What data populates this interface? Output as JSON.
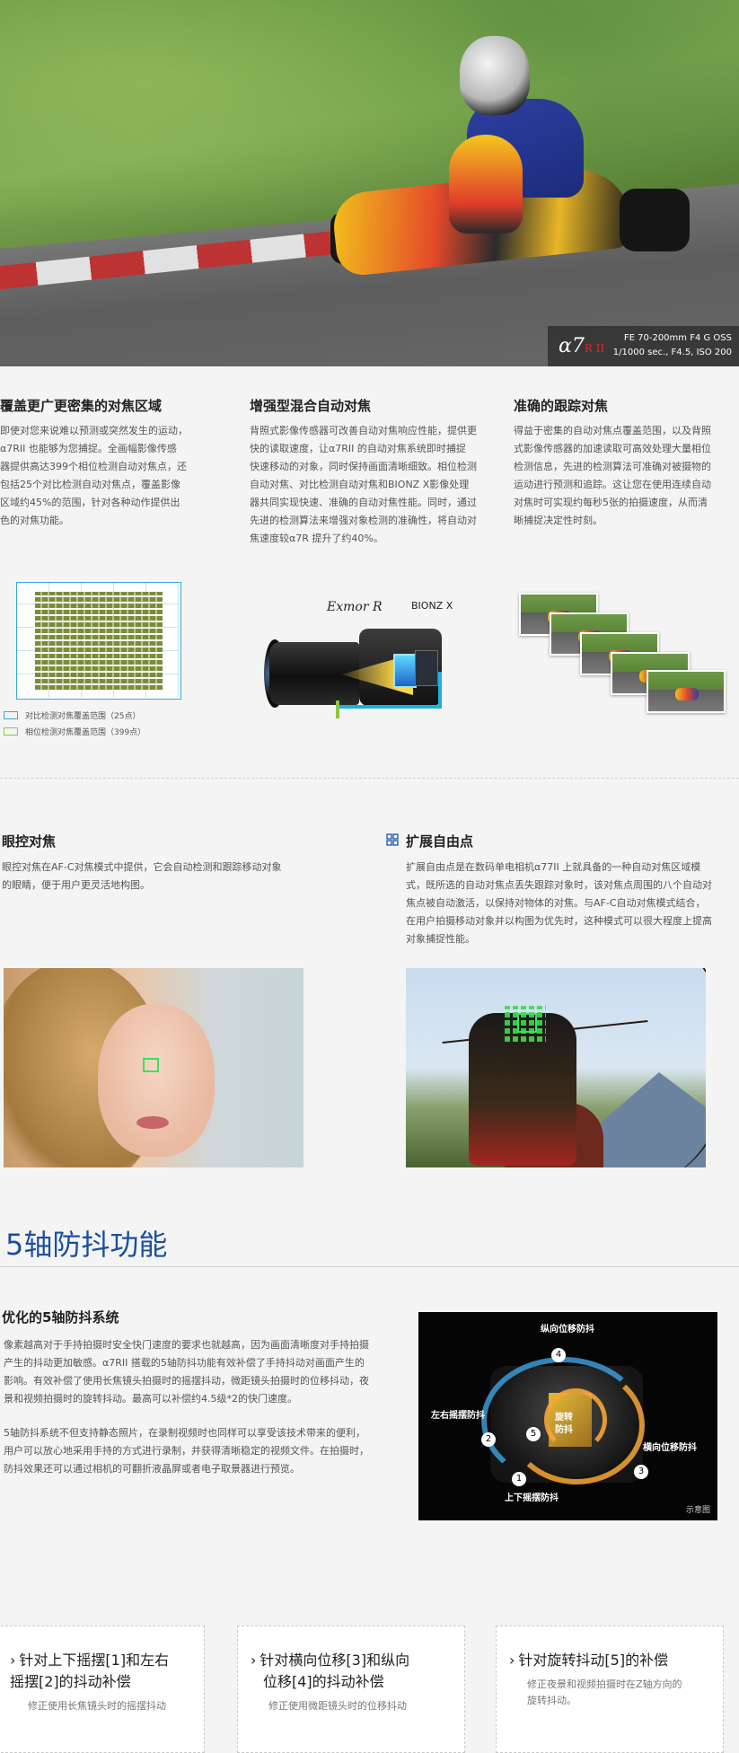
{
  "hero": {
    "badge_logo": "α7",
    "badge_logo_suffix": "R II",
    "badge_line1": "FE 70-200mm F4 G OSS",
    "badge_line2": "1/1000 sec., F4.5, ISO 200"
  },
  "section1": {
    "col1": {
      "title": "覆盖更广更密集的对焦区域",
      "body_lines": [
        "即使对您来说难以预测或突然发生的运动，",
        "α7RII 也能够为您捕捉。全画幅影像传感",
        "器提供高达399个相位检测自动对焦点，还",
        "包括25个对比检测自动对焦点，覆盖影像",
        "区域约45%的范围，针对各种动作提供出",
        "色的对焦功能。"
      ]
    },
    "col2": {
      "title": "增强型混合自动对焦",
      "body_lines": [
        "背照式影像传感器可改善自动对焦响应性能，提供更",
        "快的读取速度，让α7RII 的自动对焦系统即时捕捉",
        "快速移动的对象，同时保持画面清晰细致。相位检测",
        "自动对焦、对比检测自动对焦和BIONZ X影像处理",
        "器共同实现快速、准确的自动对焦性能。同时，通过",
        "先进的检测算法来增强对象检测的准确性，将自动对",
        "焦速度较α7R 提升了约40%。"
      ]
    },
    "col3": {
      "title": "准确的跟踪对焦",
      "body_lines": [
        "得益于密集的自动对焦点覆盖范围，以及背照",
        "式影像传感器的加速读取可高效处理大量相位",
        "检测信息，先进的检测算法可准确对被摄物的",
        "运动进行预测和追踪。这让您在使用连续自动",
        "对焦时可实现约每秒5张的拍摄速度，从而清",
        "晰捕捉决定性时刻。"
      ]
    },
    "legend": {
      "contrast": "对比检测对焦覆盖范围（25点）",
      "phase": "相位检测对焦覆盖范围（399点）"
    },
    "diagram_labels": {
      "exmor": "Exmor R",
      "bionz": "BIONZ X"
    },
    "colors": {
      "contrast": "#3aa8d8",
      "phase": "#8cc63f"
    }
  },
  "section2": {
    "eye_af": {
      "title": "眼控对焦",
      "body_lines": [
        "眼控对焦在AF-C对焦模式中提供，它会自动检测和跟踪移动对象",
        "的眼睛，便于用户更灵活地构图。"
      ]
    },
    "flex_spot": {
      "title": "扩展自由点",
      "body_lines": [
        "扩展自由点是在数码单电相机α77II 上就具备的一种自动对焦区域模",
        "式，既所选的自动对焦点丢失跟踪对象时，该对焦点周围的八个自动对",
        "焦点被自动激活，以保持对物体的对焦。与AF-C自动对焦模式结合，",
        "在用户拍摄移动对象并以构图为优先时，这种模式可以很大程度上提高",
        "对象捕捉性能。"
      ]
    }
  },
  "section3": {
    "heading": "5轴防抖功能",
    "subtitle": "优化的5轴防抖系统",
    "para1_lines": [
      "像素越高对于手持拍摄时安全快门速度的要求也就越高，因为画面清晰度对手持拍摄",
      "产生的抖动更加敏感。α7RII 搭载的5轴防抖功能有效补偿了手持抖动对画面产生的",
      "影响。有效补偿了使用长焦镜头拍摄时的摇摆抖动，微距镜头拍摄时的位移抖动，夜",
      "景和视频拍摄时的旋转抖动。最高可以补偿约4.5级*2的快门速度。"
    ],
    "para2_lines": [
      "5轴防抖系统不但支持静态照片，在录制视频时也同样可以享受该技术带来的便利，",
      "用户可以放心地采用手持的方式进行录制，并获得清晰稳定的视频文件。在拍摄时，",
      "防抖效果还可以通过相机的可翻折液晶屏或者电子取景器进行预览。"
    ],
    "diagram": {
      "label_top": "纵向位移防抖",
      "label_left": "左右摇摆防抖",
      "label_right": "横向位移防抖",
      "label_bottom": "上下摇摆防抖",
      "label_center_1": "旋转",
      "label_center_2": "防抖",
      "note": "示意图",
      "num1": "1",
      "num2": "2",
      "num3": "3",
      "num4": "4",
      "num5": "5"
    }
  },
  "cards": [
    {
      "title_line1": "针对上下摇摆[1]和左右",
      "title_line2": "摇摆[2]的抖动补偿",
      "body": "修正使用长焦镜头时的摇摆抖动"
    },
    {
      "title_line1": "针对横向位移[3]和纵向",
      "title_line2": "位移[4]的抖动补偿",
      "body": "修正使用微距镜头时的位移抖动"
    },
    {
      "title_line1": "针对旋转抖动[5]的补偿",
      "title_line2": "",
      "body_line1": "修正夜景和视频拍摄时在Z轴方向的",
      "body_line2": "旋转抖动。"
    }
  ]
}
